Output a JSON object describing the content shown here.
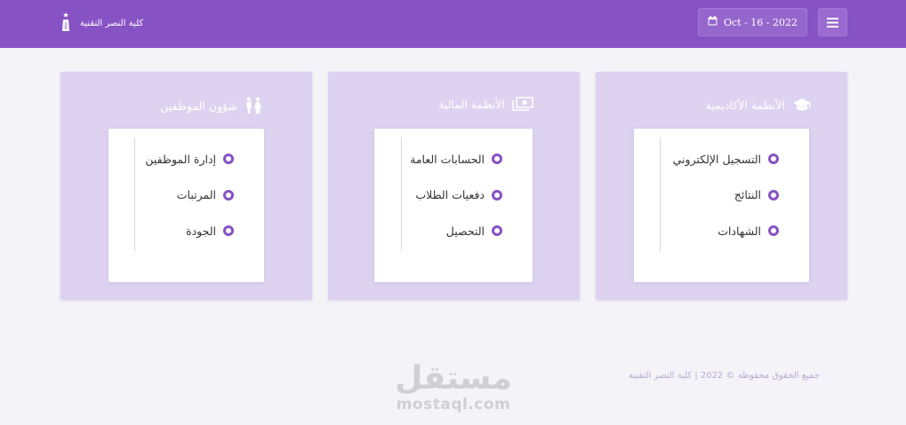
{
  "header": {
    "brand_name": "كلية النصر التقنية",
    "date": "Oct - 16 - 2022",
    "icons": {
      "menu": "hamburger-menu-icon",
      "calendar": "calendar-icon",
      "logo": "college-logo-icon"
    }
  },
  "cards": [
    {
      "title": "الأنظمة الأكاديمية",
      "icon": "graduation-cap-icon",
      "items": [
        "التسجيل الإلكتروني",
        "النتائج",
        "الشهادات"
      ]
    },
    {
      "title": "الأنظمة المالية",
      "icon": "money-icon",
      "items": [
        "الحسابات العامة",
        "دفعيات الطلاب",
        "التحصيل"
      ]
    },
    {
      "title": "شؤون الموظفين",
      "icon": "staff-icon",
      "items": [
        "إدارة الموظفين",
        "المرتبات",
        "الجودة"
      ]
    }
  ],
  "footer": {
    "copyright": "جميع الحقوق محفوظة © 2022 | كلية النصر التقنية"
  },
  "watermark": {
    "arabic": "مستقل",
    "latin": "mostaql.com"
  },
  "colors": {
    "primary": "#8752c4",
    "card_bg": "#ddd3f0",
    "page_bg": "#f4f3f8"
  }
}
